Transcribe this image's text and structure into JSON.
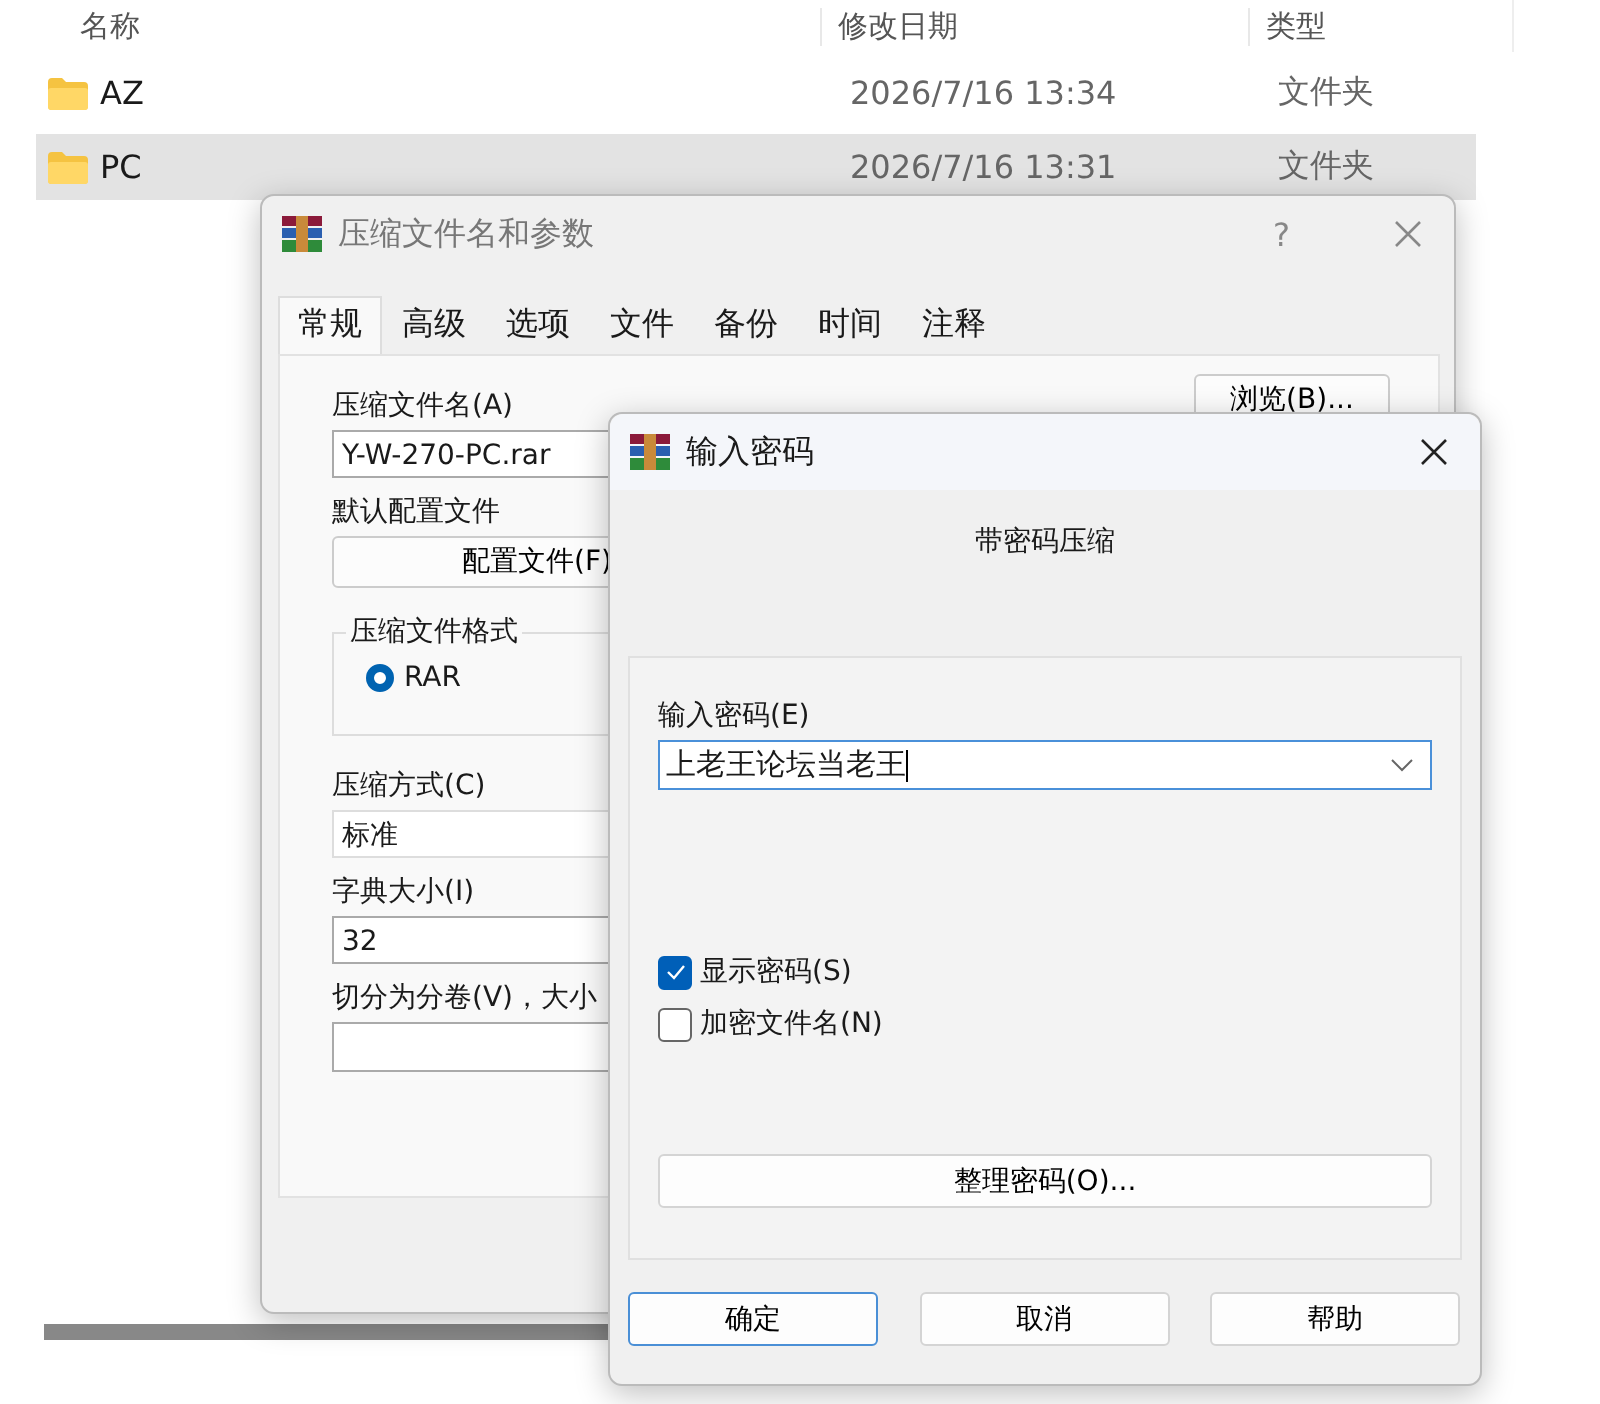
{
  "explorer": {
    "columns": [
      "名称",
      "修改日期",
      "类型"
    ],
    "rows": [
      {
        "name": "AZ",
        "modified": "2026/7/16 13:34",
        "type": "文件夹",
        "selected": false
      },
      {
        "name": "PC",
        "modified": "2026/7/16 13:31",
        "type": "文件夹",
        "selected": true
      }
    ]
  },
  "archive_dialog": {
    "title": "压缩文件名和参数",
    "help": "?",
    "tabs": [
      {
        "label": "常规",
        "selected": true
      },
      {
        "label": "高级",
        "selected": false
      },
      {
        "label": "选项",
        "selected": false
      },
      {
        "label": "文件",
        "selected": false
      },
      {
        "label": "备份",
        "selected": false
      },
      {
        "label": "时间",
        "selected": false
      },
      {
        "label": "注释",
        "selected": false
      }
    ],
    "archive_name_label": "压缩文件名(A)",
    "archive_name": "Y-W-270-PC.rar",
    "browse_button": "浏览(B)...",
    "profile_label": "默认配置文件",
    "profile_button": "配置文件(F)",
    "format_group": "压缩文件格式",
    "formats": [
      {
        "label": "RAR",
        "selected": true
      }
    ],
    "method_label": "压缩方式(C)",
    "method": "标准",
    "dictionary_label": "字典大小(I)",
    "dictionary": "32",
    "split_label": "切分为分卷(V)，大小"
  },
  "password_dialog": {
    "title": "输入密码",
    "heading": "带密码压缩",
    "password_label": "输入密码(E)",
    "password": "上老王论坛当老王",
    "options": [
      {
        "label": "显示密码(S)",
        "checked": true
      },
      {
        "label": "加密文件名(N)",
        "checked": false
      }
    ],
    "organize_button": "整理密码(O)...",
    "buttons": [
      {
        "label": "确定",
        "default": true
      },
      {
        "label": "取消",
        "default": false
      },
      {
        "label": "帮助",
        "default": false
      }
    ]
  }
}
